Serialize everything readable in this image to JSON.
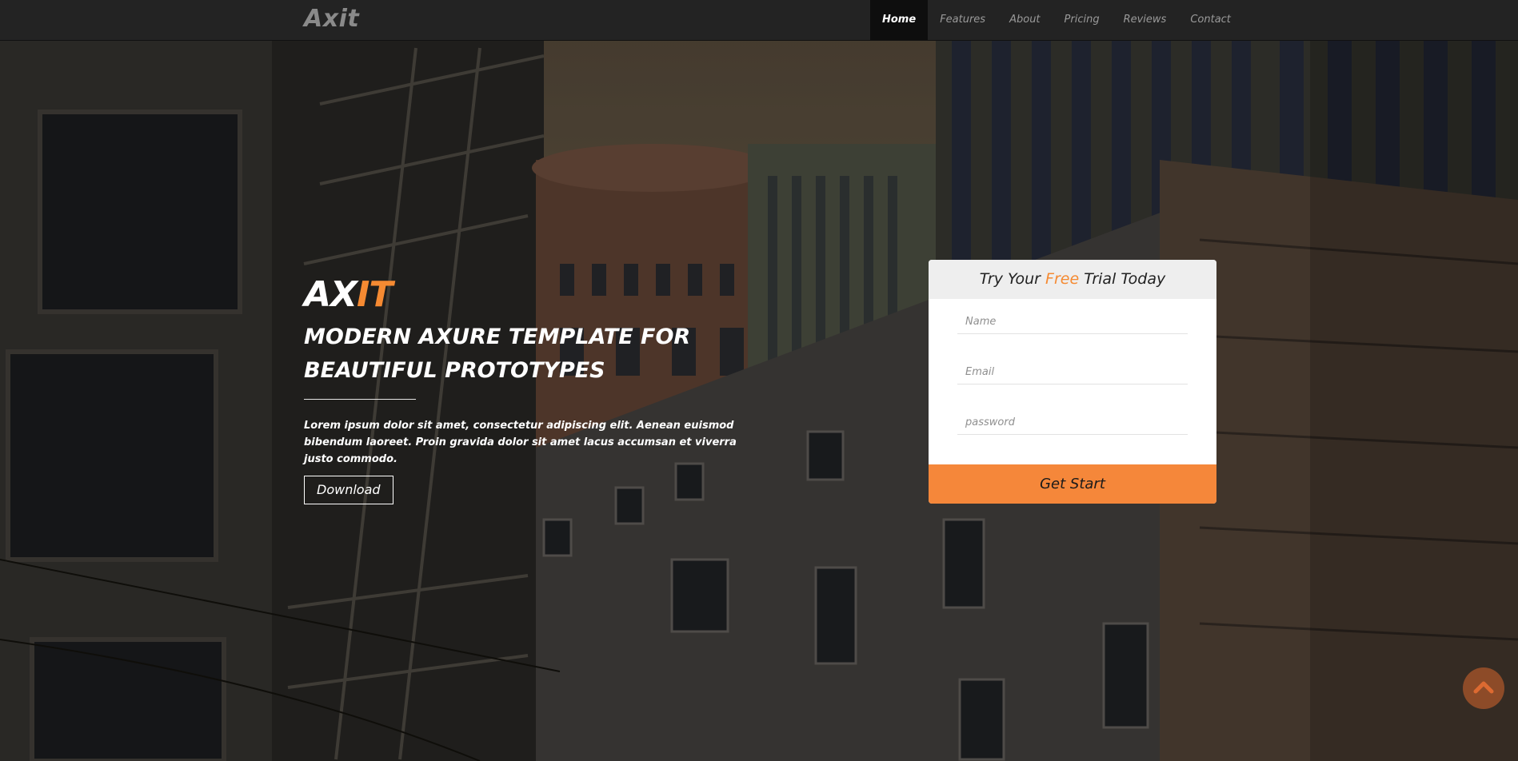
{
  "brand": {
    "name": "Axit"
  },
  "nav": {
    "items": [
      {
        "label": "Home",
        "active": true
      },
      {
        "label": "Features"
      },
      {
        "label": "About"
      },
      {
        "label": "Pricing"
      },
      {
        "label": "Reviews"
      },
      {
        "label": "Contact"
      }
    ]
  },
  "hero": {
    "logo_main": "AX",
    "logo_accent": "IT",
    "title": "MODERN AXURE TEMPLATE FOR BEAUTIFUL PROTOTYPES",
    "description": "Lorem ipsum dolor sit amet, consectetur adipiscing elit. Aenean euismod bibendum laoreet. Proin gravida dolor sit amet lacus accumsan et viverra justo commodo.",
    "download_label": "Download"
  },
  "trial_form": {
    "heading_pre": "Try Your ",
    "heading_accent": "Free",
    "heading_post": " Trial Today",
    "name_placeholder": "Name",
    "email_placeholder": "Email",
    "password_placeholder": "password",
    "submit_label": "Get Start"
  },
  "icons": {
    "back_to_top": "chevron-up-icon"
  },
  "colors": {
    "accent": "#f58a32",
    "navbar": "#232323",
    "nav_active": "#0e0e0e",
    "form_header": "#eeeeee"
  }
}
